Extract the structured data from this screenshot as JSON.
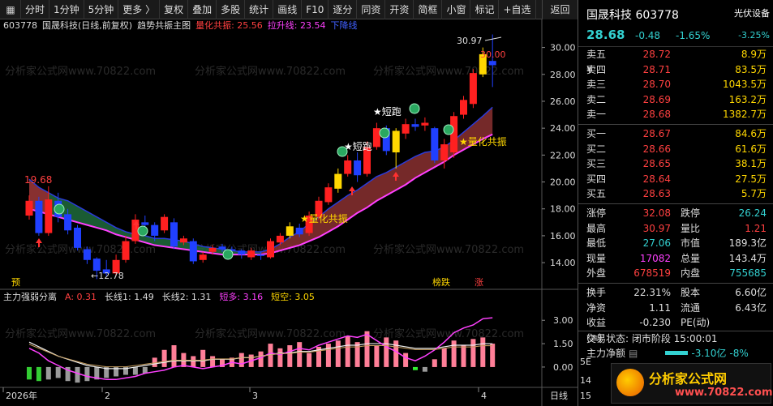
{
  "toolbar": {
    "items": [
      "分时",
      "1分钟",
      "5分钟",
      "更多 〉",
      "复权",
      "叠加",
      "多股",
      "统计",
      "画线",
      "F10",
      "逐分",
      "同资",
      "开资",
      "简框",
      "小窗",
      "标记",
      "+自选"
    ],
    "back": "返回"
  },
  "legend_main": {
    "code": "603778",
    "title": "国晟科技(日线,前复权)",
    "indicator": "趋势共振主图",
    "lh_label": "量化共振: 25.56",
    "ls_label": "拉升线: 23.54",
    "tail": "下降线"
  },
  "legend_sub": {
    "name": "主力强弱分离",
    "a": "A: 0.31",
    "l1": "长线1: 1.49",
    "l2": "长线2: 1.31",
    "dd": "短多: 3.16",
    "dk": "短空: 3.05"
  },
  "annotations": {
    "high_label": "30.97",
    "high2": "30.00",
    "left_high": "19.68",
    "low": "←12.78",
    "tag_pre": "预",
    "tag_bang": "榜跌",
    "tag_zhang": "涨",
    "s1": "★短跑",
    "s2": "★短跑",
    "q1": "★量化共振",
    "q2": "★量化共振",
    "watermark": "分析家公式网www.70822.com"
  },
  "axes": {
    "price_ticks": [
      "30.00",
      "28.00",
      "26.00",
      "24.00",
      "22.00",
      "20.00",
      "18.00",
      "16.00",
      "14.00"
    ],
    "sub_ticks": [
      "3.00",
      "1.50",
      "0.00"
    ],
    "x_ticks": [
      "2026年",
      "2",
      "3",
      "4"
    ],
    "x_right": "日线"
  },
  "panel": {
    "name": "国晟科技 603778",
    "sector": "光伏设备",
    "price": "28.68",
    "change": "-0.48",
    "pct": "-1.65%",
    "sector_pct": "-3.25%",
    "asks": [
      {
        "label": "卖五 ¥",
        "price": "28.72",
        "vol": "8.9万"
      },
      {
        "label": "卖四",
        "price": "28.71",
        "vol": "83.5万"
      },
      {
        "label": "卖三",
        "price": "28.70",
        "vol": "1043.5万"
      },
      {
        "label": "卖二",
        "price": "28.69",
        "vol": "163.2万"
      },
      {
        "label": "卖一",
        "price": "28.68",
        "vol": "1382.7万"
      }
    ],
    "bids": [
      {
        "label": "买一",
        "price": "28.67",
        "vol": "84.6万"
      },
      {
        "label": "买二",
        "price": "28.66",
        "vol": "61.6万"
      },
      {
        "label": "买三",
        "price": "28.65",
        "vol": "38.1万"
      },
      {
        "label": "买四",
        "price": "28.64",
        "vol": "27.5万"
      },
      {
        "label": "买五",
        "price": "28.63",
        "vol": "5.7万"
      }
    ],
    "stats1": [
      {
        "k": "涨停",
        "v": "32.08",
        "vc": "red",
        "k2": "跌停",
        "v2": "26.24",
        "v2c": "cyan"
      },
      {
        "k": "最高",
        "v": "30.97",
        "vc": "red",
        "k2": "量比",
        "v2": "1.21",
        "v2c": "red"
      },
      {
        "k": "最低",
        "v": "27.06",
        "vc": "cyan",
        "k2": "市值",
        "v2": "189.3亿",
        "v2c": "white"
      },
      {
        "k": "现量",
        "v": "17082",
        "vc": "magenta",
        "k2": "总量",
        "v2": "143.4万",
        "v2c": "white"
      },
      {
        "k": "外盘",
        "v": "678519",
        "vc": "red",
        "k2": "内盘",
        "v2": "755685",
        "v2c": "cyan"
      }
    ],
    "stats2": [
      {
        "k": "换手",
        "v": "22.31%",
        "vc": "white",
        "k2": "股本",
        "v2": "6.60亿",
        "v2c": "white"
      },
      {
        "k": "净资",
        "v": "1.11",
        "vc": "white",
        "k2": "流通",
        "v2": "6.43亿",
        "v2c": "white"
      },
      {
        "k": "收益(≡)",
        "v": "-0.230",
        "vc": "white",
        "k2": "PE(动)",
        "v2": "",
        "v2c": "white"
      }
    ],
    "trade_state": "交易状态: 闭市阶段 15:00:01",
    "mainflow_label": "主力净额",
    "mainflow_val": "-3.10亿",
    "mainflow_pct": "-8%",
    "stubs": [
      "5E",
      "14",
      "15"
    ],
    "brand_name": "分析家公式网",
    "brand_url": "www.70822.com"
  },
  "chart_data": {
    "type": "candlestick",
    "price_range": [
      12.5,
      31.0
    ],
    "sub_range": [
      -1.2,
      4.0
    ],
    "candles": [
      {
        "o": 17.5,
        "c": 18.6,
        "h": 19.0,
        "l": 17.2
      },
      {
        "o": 18.6,
        "c": 16.2,
        "h": 18.9,
        "l": 16.0
      },
      {
        "o": 16.2,
        "c": 18.7,
        "h": 19.68,
        "l": 16.0
      },
      {
        "o": 18.6,
        "c": 17.4,
        "h": 19.2,
        "l": 17.0
      },
      {
        "o": 17.6,
        "c": 16.4,
        "h": 18.0,
        "l": 16.1
      },
      {
        "o": 16.6,
        "c": 15.1,
        "h": 16.8,
        "l": 14.9
      },
      {
        "o": 15.0,
        "c": 14.2,
        "h": 15.2,
        "l": 13.9
      },
      {
        "o": 14.3,
        "c": 13.4,
        "h": 14.4,
        "l": 12.78
      },
      {
        "o": 13.5,
        "c": 13.2,
        "h": 14.2,
        "l": 13.0
      },
      {
        "o": 13.2,
        "c": 14.2,
        "h": 14.6,
        "l": 13.0
      },
      {
        "o": 14.2,
        "c": 15.6,
        "h": 16.0,
        "l": 14.0
      },
      {
        "o": 15.6,
        "c": 17.2,
        "h": 17.6,
        "l": 15.4
      },
      {
        "o": 17.0,
        "c": 16.8,
        "h": 17.5,
        "l": 16.5
      },
      {
        "o": 16.8,
        "c": 16.0,
        "h": 17.0,
        "l": 15.6
      },
      {
        "o": 16.4,
        "c": 17.4,
        "h": 17.6,
        "l": 16.2
      },
      {
        "o": 17.0,
        "c": 15.2,
        "h": 17.3,
        "l": 15.0
      },
      {
        "o": 15.5,
        "c": 15.8,
        "h": 16.0,
        "l": 15.3
      },
      {
        "o": 15.6,
        "c": 14.1,
        "h": 15.8,
        "l": 13.9
      },
      {
        "o": 14.2,
        "c": 14.6,
        "h": 14.8,
        "l": 14.0
      },
      {
        "o": 14.8,
        "c": 15.1,
        "h": 15.3,
        "l": 14.6
      },
      {
        "o": 15.2,
        "c": 15.0,
        "h": 15.4,
        "l": 14.8
      },
      {
        "o": 15.0,
        "c": 14.9,
        "h": 15.2,
        "l": 14.6
      },
      {
        "o": 14.9,
        "c": 14.6,
        "h": 15.0,
        "l": 14.3
      },
      {
        "o": 14.4,
        "c": 14.9,
        "h": 15.1,
        "l": 14.2
      },
      {
        "o": 14.6,
        "c": 14.5,
        "h": 14.8,
        "l": 14.2
      },
      {
        "o": 14.4,
        "c": 15.6,
        "h": 15.8,
        "l": 14.3
      },
      {
        "o": 15.5,
        "c": 16.0,
        "h": 16.2,
        "l": 15.3
      },
      {
        "o": 16.0,
        "c": 16.7,
        "h": 17.0,
        "l": 15.8
      },
      {
        "o": 16.6,
        "c": 16.1,
        "h": 16.9,
        "l": 15.9
      },
      {
        "o": 16.2,
        "c": 17.5,
        "h": 17.8,
        "l": 16.0
      },
      {
        "o": 17.4,
        "c": 18.6,
        "h": 18.9,
        "l": 17.2
      },
      {
        "o": 18.5,
        "c": 19.6,
        "h": 19.9,
        "l": 18.3
      },
      {
        "o": 19.5,
        "c": 20.6,
        "h": 21.0,
        "l": 19.2
      },
      {
        "o": 20.6,
        "c": 21.6,
        "h": 22.0,
        "l": 20.4
      },
      {
        "o": 21.6,
        "c": 20.5,
        "h": 22.2,
        "l": 20.0
      },
      {
        "o": 20.6,
        "c": 22.6,
        "h": 23.0,
        "l": 20.4
      },
      {
        "o": 22.6,
        "c": 24.0,
        "h": 24.4,
        "l": 22.4
      },
      {
        "o": 24.0,
        "c": 22.3,
        "h": 24.2,
        "l": 22.0
      },
      {
        "o": 22.2,
        "c": 23.8,
        "h": 24.0,
        "l": 21.0
      },
      {
        "o": 23.6,
        "c": 24.3,
        "h": 24.7,
        "l": 23.2
      },
      {
        "o": 24.3,
        "c": 24.1,
        "h": 24.7,
        "l": 23.8
      },
      {
        "o": 24.2,
        "c": 24.4,
        "h": 24.8,
        "l": 23.8
      },
      {
        "o": 24.0,
        "c": 21.6,
        "h": 24.1,
        "l": 21.4
      },
      {
        "o": 21.6,
        "c": 22.8,
        "h": 23.2,
        "l": 21.0
      },
      {
        "o": 22.2,
        "c": 24.9,
        "h": 25.2,
        "l": 21.8
      },
      {
        "o": 25.0,
        "c": 26.1,
        "h": 26.4,
        "l": 24.7
      },
      {
        "o": 25.8,
        "c": 28.1,
        "h": 28.4,
        "l": 25.5
      },
      {
        "o": 28.0,
        "c": 29.5,
        "h": 30.0,
        "l": 27.8
      },
      {
        "o": 29.0,
        "c": 28.68,
        "h": 30.97,
        "l": 27.06
      }
    ],
    "band_upper": [
      20.2,
      19.6,
      19.2,
      18.8,
      18.6,
      18.2,
      17.8,
      17.4,
      17.0,
      16.6,
      16.3,
      16.1,
      16.0,
      15.8,
      15.8,
      15.7,
      15.6,
      15.4,
      15.2,
      15.1,
      15.0,
      14.9,
      14.8,
      14.8,
      14.8,
      15.0,
      15.4,
      15.9,
      16.3,
      16.9,
      17.4,
      18.0,
      18.5,
      19.0,
      19.4,
      19.9,
      20.4,
      20.7,
      21.1,
      21.5,
      21.9,
      22.2,
      22.3,
      22.6,
      23.1,
      23.7,
      24.3,
      24.9,
      25.56
    ],
    "band_lower": [
      18.0,
      17.8,
      17.6,
      17.4,
      17.2,
      17.0,
      16.8,
      16.6,
      16.4,
      16.1,
      15.9,
      15.7,
      15.5,
      15.3,
      15.2,
      15.1,
      15.0,
      14.9,
      14.8,
      14.7,
      14.6,
      14.6,
      14.6,
      14.6,
      14.6,
      14.7,
      14.9,
      15.1,
      15.3,
      15.6,
      15.9,
      16.3,
      16.7,
      17.2,
      17.7,
      18.1,
      18.6,
      19.0,
      19.4,
      19.8,
      20.3,
      20.7,
      21.1,
      21.5,
      22.0,
      22.4,
      22.8,
      23.2,
      23.54
    ],
    "sub_bars": [
      -0.8,
      -0.9,
      -0.8,
      -0.7,
      -0.9,
      -1.0,
      -0.9,
      -0.8,
      -0.7,
      -0.6,
      -0.5,
      -0.5,
      -0.4,
      0.6,
      1.1,
      1.4,
      0.9,
      0.7,
      1.1,
      0.7,
      0.5,
      0.6,
      0.9,
      0.8,
      1.0,
      1.5,
      1.2,
      1.4,
      1.6,
      0.9,
      1.3,
      1.5,
      1.7,
      2.0,
      1.6,
      2.3,
      1.4,
      1.9,
      1.7,
      0.9,
      -0.2,
      -0.3,
      0.5,
      1.2,
      1.7,
      1.4,
      1.8,
      1.9,
      1.5
    ],
    "sub_line_pink": [
      1.2,
      0.9,
      0.4,
      0.1,
      -0.2,
      -0.4,
      -0.6,
      -0.7,
      -0.8,
      -0.8,
      -0.7,
      -0.6,
      -0.4,
      -0.3,
      -0.2,
      0.0,
      0.1,
      0.0,
      -0.1,
      0.0,
      0.1,
      0.3,
      0.2,
      0.4,
      0.6,
      0.9,
      0.8,
      1.0,
      1.2,
      1.1,
      1.4,
      1.6,
      1.8,
      2.0,
      1.9,
      2.1,
      1.7,
      1.3,
      1.0,
      0.6,
      0.4,
      0.7,
      1.1,
      1.6,
      2.2,
      2.5,
      2.7,
      3.1,
      3.16
    ],
    "sub_line_white": [
      1.6,
      1.3,
      1.0,
      0.7,
      0.5,
      0.3,
      0.1,
      0.0,
      -0.1,
      -0.1,
      -0.1,
      0.0,
      0.1,
      0.2,
      0.3,
      0.4,
      0.4,
      0.4,
      0.4,
      0.5,
      0.5,
      0.5,
      0.6,
      0.6,
      0.7,
      0.8,
      0.9,
      0.9,
      1.0,
      1.0,
      1.1,
      1.2,
      1.3,
      1.4,
      1.4,
      1.5,
      1.5,
      1.5,
      1.4,
      1.3,
      1.2,
      1.2,
      1.2,
      1.3,
      1.4,
      1.4,
      1.4,
      1.5,
      1.49
    ]
  }
}
